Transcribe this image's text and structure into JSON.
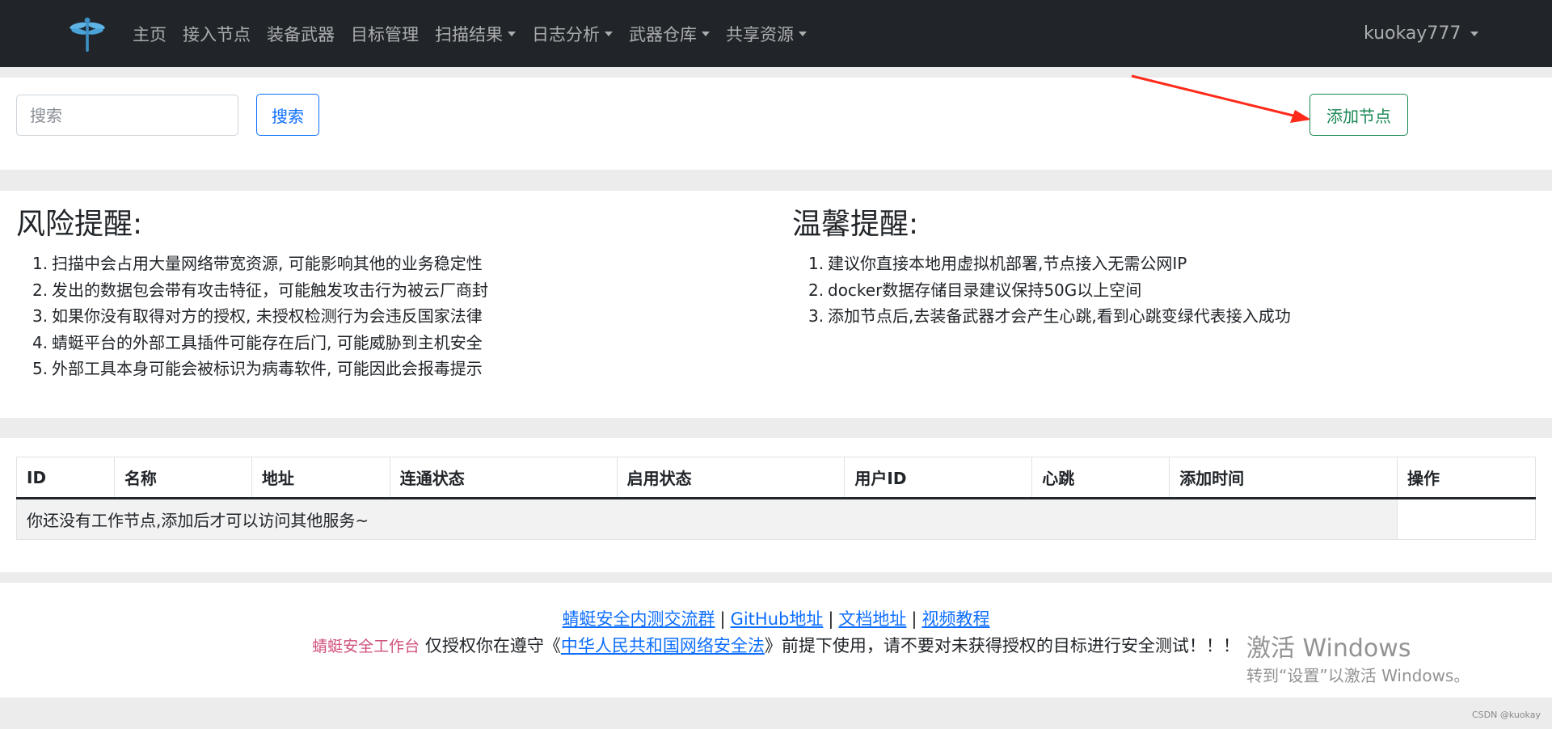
{
  "navbar": {
    "logo_icon": "dragonfly-logo-icon",
    "items": [
      {
        "label": "主页",
        "dropdown": false
      },
      {
        "label": "接入节点",
        "dropdown": false
      },
      {
        "label": "装备武器",
        "dropdown": false
      },
      {
        "label": "目标管理",
        "dropdown": false
      },
      {
        "label": "扫描结果",
        "dropdown": true
      },
      {
        "label": "日志分析",
        "dropdown": true
      },
      {
        "label": "武器仓库",
        "dropdown": true
      },
      {
        "label": "共享资源",
        "dropdown": true
      }
    ],
    "user": "kuokay777"
  },
  "search": {
    "placeholder": "搜索",
    "button_label": "搜索",
    "add_button_label": "添加节点"
  },
  "annotation_arrow_color": "#ff2a1a",
  "tips": {
    "risk_title": "风险提醒:",
    "risk_items": [
      "扫描中会占用大量网络带宽资源, 可能影响其他的业务稳定性",
      "发出的数据包会带有攻击特征，可能触发攻击行为被云厂商封",
      "如果你没有取得对方的授权, 未授权检测行为会违反国家法律",
      "蜻蜓平台的外部工具插件可能存在后门, 可能威胁到主机安全",
      "外部工具本身可能会被标识为病毒软件, 可能因此会报毒提示"
    ],
    "warm_title": "温馨提醒:",
    "warm_items": [
      "建议你直接本地用虚拟机部署,节点接入无需公网IP",
      "docker数据存储目录建议保持50G以上空间",
      "添加节点后,去装备武器才会产生心跳,看到心跳变绿代表接入成功"
    ]
  },
  "table": {
    "headers": [
      "ID",
      "名称",
      "地址",
      "连通状态",
      "启用状态",
      "用户ID",
      "心跳",
      "添加时间",
      "操作"
    ],
    "empty_message": "你还没有工作节点,添加后才可以访问其他服务~"
  },
  "footer": {
    "links": [
      "蜻蜓安全内测交流群",
      "GitHub地址",
      "文档地址",
      "视频教程"
    ],
    "separator": "|",
    "brand": "蜻蜓安全工作台",
    "notice_prefix": " 仅授权你在遵守《",
    "law_link": "中华人民共和国网络安全法",
    "notice_suffix": "》前提下使用，请不要对未获得授权的目标进行安全测试！！！"
  },
  "watermark": {
    "line1": "激活 Windows",
    "line2": "转到“设置”以激活 Windows。"
  },
  "csdn_mark": "CSDN @kuokay",
  "colors": {
    "navbar_bg": "#212529",
    "primary": "#0d6efd",
    "success": "#198754",
    "brand_pink": "#d0517a"
  }
}
